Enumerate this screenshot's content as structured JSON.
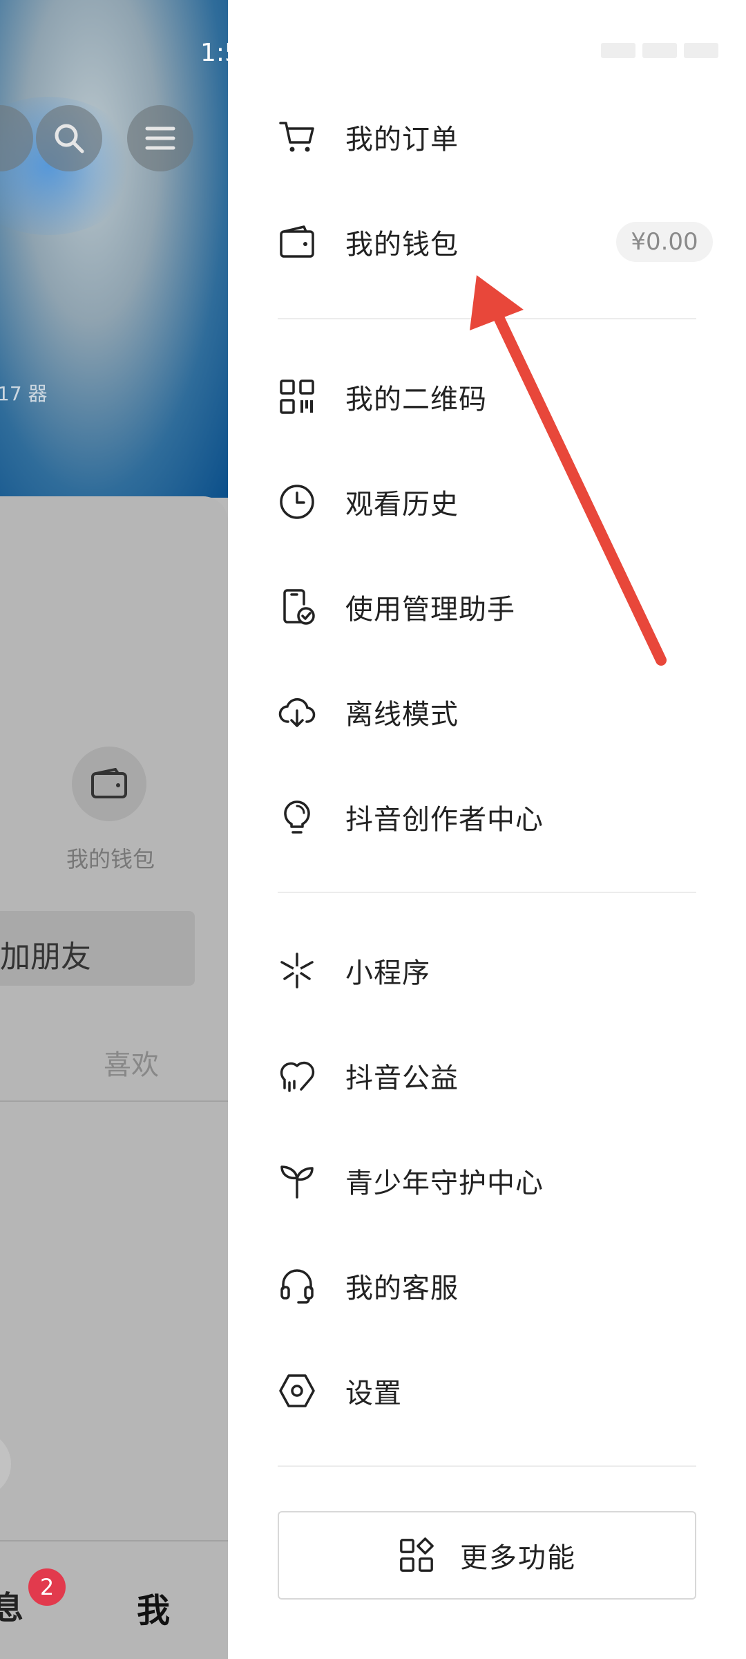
{
  "status_bar": {
    "time": "1:5"
  },
  "background": {
    "faint_text": "17 器",
    "wallet_label": "我的钱包",
    "add_friend_label": "加朋友",
    "likes_tab": "喜欢",
    "bottom_tabs": {
      "messages": "息",
      "me": "我"
    },
    "messages_badge": "2"
  },
  "drawer": {
    "group1": [
      {
        "label": "我的订单",
        "icon": "cart-icon"
      },
      {
        "label": "我的钱包",
        "icon": "wallet-icon",
        "balance": "¥0.00"
      }
    ],
    "group2": [
      {
        "label": "我的二维码",
        "icon": "qr-code-icon"
      },
      {
        "label": "观看历史",
        "icon": "clock-icon"
      },
      {
        "label": "使用管理助手",
        "icon": "phone-check-icon"
      },
      {
        "label": "离线模式",
        "icon": "cloud-download-icon"
      },
      {
        "label": "抖音创作者中心",
        "icon": "lightbulb-icon"
      }
    ],
    "group3": [
      {
        "label": "小程序",
        "icon": "mini-program-icon"
      },
      {
        "label": "抖音公益",
        "icon": "charity-heart-icon"
      },
      {
        "label": "青少年守护中心",
        "icon": "sprout-icon"
      },
      {
        "label": "我的客服",
        "icon": "headset-icon"
      },
      {
        "label": "设置",
        "icon": "settings-hexagon-icon"
      }
    ],
    "more_button": {
      "label": "更多功能",
      "icon": "grid-apps-icon"
    }
  },
  "annotation": {
    "arrow_color": "#e8473a"
  }
}
